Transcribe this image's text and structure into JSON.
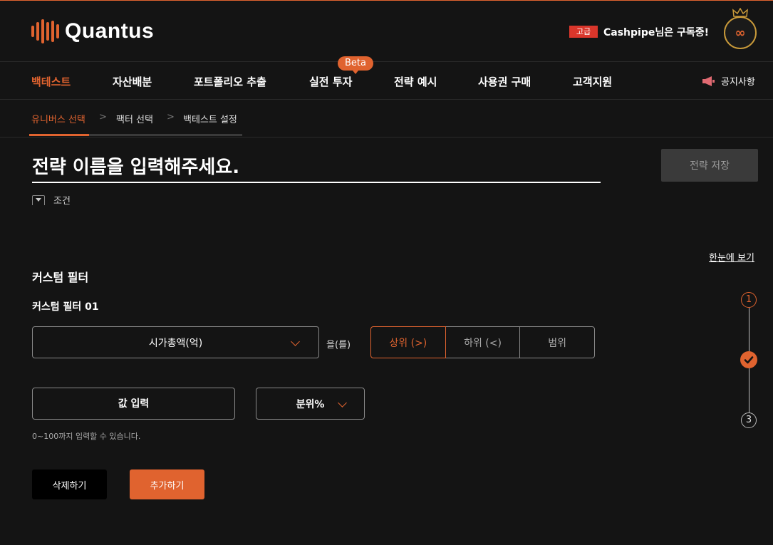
{
  "brand": {
    "name": "Quantus",
    "accent": "#e0632f"
  },
  "subscription": {
    "tier": "고급",
    "message": "Cashpipe님은 구독중!",
    "avatar_symbol": "∞"
  },
  "nav": {
    "items": [
      "백테스트",
      "자산배분",
      "포트폴리오 추출",
      "실전 투자",
      "전략 예시",
      "사용권 구매",
      "고객지원"
    ],
    "active": "백테스트",
    "beta_label": "Beta",
    "notice_label": "공지사항"
  },
  "steps": {
    "items": [
      "유니버스 선택",
      "팩터 선택",
      "백테스트 설정"
    ],
    "active": "유니버스 선택",
    "separator": ">"
  },
  "strategy": {
    "name_placeholder": "전략 이름을 입력해주세요.",
    "save_label": "전략 저장"
  },
  "condition": {
    "label": "조건"
  },
  "overview_link": "한눈에 보기",
  "custom_filter": {
    "section_title": "커스텀 필터",
    "filter_title": "커스텀 필터 01",
    "metric_selected": "시가총액(억)",
    "particle": "을(를)",
    "direction_options": [
      "상위 (>)",
      "하위 (<)",
      "범위"
    ],
    "direction_selected": "상위 (>)",
    "value_placeholder": "값 입력",
    "unit_selected": "분위%",
    "hint": "0~100까지 입력할 수 있습니다.",
    "delete_label": "삭제하기",
    "add_label": "추가하기"
  },
  "progress": {
    "steps": [
      "1",
      "✓",
      "3"
    ],
    "current": 2
  }
}
